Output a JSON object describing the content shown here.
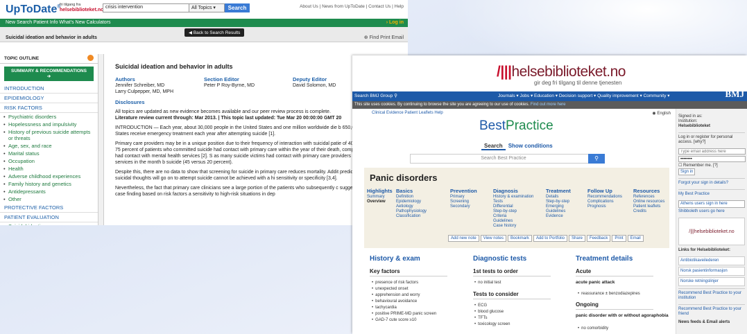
{
  "utd": {
    "logo": "UpToDate",
    "reg": "®",
    "free_line1": "fri tilgang fra",
    "free_line2": "helsebiblioteket.no",
    "search_value": "crisis intervention",
    "topics_label": "All Topics",
    "search_button": "Search",
    "top_links": "About Us  |  News from UpToDate  |  Contact Us  |  Help",
    "nav": "New Search   Patient Info   What's New   Calculators",
    "login": "› Log in",
    "back_button": "Back to Search Results",
    "page_title": "Suicidal ideation and behavior in adults",
    "tools": "Find   Print   Email",
    "outline_header": "TOPIC OUTLINE",
    "summary_button": "SUMMARY & RECOMMENDATIONS",
    "outline": [
      {
        "t": "sec",
        "label": "INTRODUCTION"
      },
      {
        "t": "sec",
        "label": "EPIDEMIOLOGY"
      },
      {
        "t": "sec",
        "label": "RISK FACTORS"
      },
      {
        "t": "item",
        "label": "Psychiatric disorders"
      },
      {
        "t": "item",
        "label": "Hopelessness and impulsivity"
      },
      {
        "t": "item",
        "label": "History of previous suicide attempts or threats"
      },
      {
        "t": "item",
        "label": "Age, sex, and race"
      },
      {
        "t": "item",
        "label": "Marital status"
      },
      {
        "t": "item",
        "label": "Occupation"
      },
      {
        "t": "item",
        "label": "Health"
      },
      {
        "t": "item",
        "label": "Adverse childhood experiences"
      },
      {
        "t": "item",
        "label": "Family history and genetics"
      },
      {
        "t": "item",
        "label": "Antidepressants"
      },
      {
        "t": "item",
        "label": "Other"
      },
      {
        "t": "sec",
        "label": "PROTECTIVE FACTORS"
      },
      {
        "t": "sec",
        "label": "PATIENT EVALUATION"
      },
      {
        "t": "item",
        "label": "Suicidal ideation"
      },
      {
        "t": "item",
        "label": "Other evaluation"
      }
    ],
    "article_title": "Suicidal ideation and behavior in adults",
    "authors_h": "Authors",
    "authors": "Jennifer Schreiber, MD\nLarry Culpepper, MD, MPH",
    "section_h": "Section Editor",
    "section": "Peter P Roy-Byrne, MD",
    "deputy_h": "Deputy Editor",
    "deputy": "David Solomon, MD",
    "disclosures": "Disclosures",
    "p1": "All topics are updated as new evidence becomes available and our peer review process is complete.",
    "p1b": "Literature review current through: Mar 2013. | This topic last updated: Tue Mar 20 00:00:00 GMT 20",
    "p2": "INTRODUCTION — Each year, about 30,000 people in the United States and one million worldwide die b 650,000 people in the United States receive emergency treatment each year after attempting suicide [1].",
    "p3": "Primary care providers may be in a unique position due to their frequency of interaction with suicidal patie of 40 studies found that over 75 percent of patients who committed suicide had contact with primary care within the year of their death, compared with one-third who had contact with mental health services [2]. S as many suicide victims had contact with primary care providers as mental health services in the month b suicide (45 versus 20 percent).",
    "p4": "Despite this, there are no data to show that screening for suicide in primary care reduces mortality. Addit predicting which patients with suicidal thoughts will go on to attempt suicide cannot be achieved with a hi sensitivity or specificity [3,4].",
    "p5": "Nevertheless, the fact that primary care clinicians see a large portion of the patients who subsequently c suggests that an approach to case finding based on risk factors a sensitivity to high-risk situations in dep"
  },
  "bp": {
    "hb_logo_a": "/|||",
    "hb_logo_b": "helsebiblioteket.no",
    "hb_tag": "gir deg fri tilgang til denne tjenesten",
    "group_search": "Search BMJ Group",
    "menu": "Journals ▾   Jobs ▾   Education ▾   Decision support ▾   Quality improvement ▾   Community ▾",
    "bmj": "BMJ",
    "cookie": "This site uses cookies. By continuing to browse the site you are agreeing to our use of cookies.",
    "cookie_link": "Find out more here",
    "top_links": "Clinical Evidence      Patient Leaflets      Help",
    "english": "English",
    "logo_a": "Best",
    "logo_b": "Practice",
    "tab_search": "Search",
    "tab_show": "Show conditions",
    "search_placeholder": "Search Best Practice",
    "condition": "Panic disorders",
    "columns": [
      {
        "h": "Highlights",
        "items": [
          "Summary",
          "Overview"
        ]
      },
      {
        "h": "Basics",
        "items": [
          "Definition",
          "Epidemiology",
          "Aetiology",
          "Pathophysiology",
          "Classification"
        ]
      },
      {
        "h": "Prevention",
        "items": [
          "Primary",
          "Screening",
          "Secondary"
        ]
      },
      {
        "h": "Diagnosis",
        "items": [
          "History & examination",
          "Tests",
          "Differential",
          "Step-by-step",
          "Criteria",
          "Guidelines",
          "Case history"
        ]
      },
      {
        "h": "Treatment",
        "items": [
          "Details",
          "Step-by-step",
          "Emerging",
          "Guidelines",
          "Evidence"
        ]
      },
      {
        "h": "Follow Up",
        "items": [
          "Recommendations",
          "Complications",
          "Prognosis"
        ]
      },
      {
        "h": "Resources",
        "items": [
          "References",
          "Online resources",
          "Patient leaflets",
          "Credits"
        ]
      }
    ],
    "actions": [
      "Add new note",
      "View notes",
      "Bookmark",
      "Add to Portfolio",
      "Share",
      "Feedback",
      "Print",
      "Email"
    ],
    "hx_title": "History & exam",
    "dx_title": "Diagnostic tests",
    "tx_title": "Treatment details",
    "key_factors": "Key factors",
    "key_list": [
      "presence of risk factors",
      "unexpected onset",
      "apprehension and worry",
      "behavioural avoidance",
      "tachycardia",
      "positive PRIME-MD panic screen",
      "GAD-7 cute score ≥10"
    ],
    "first_tests": "1st tests to order",
    "first_list": [
      "no initial test"
    ],
    "consider": "Tests to consider",
    "consider_list": [
      "ECG",
      "blood glucose",
      "TFTs",
      "toxicology screen"
    ],
    "acute": "Acute",
    "acute_attack": "acute panic attack",
    "acute_list": [
      "reassurance ± benzodiazepines"
    ],
    "ongoing": "Ongoing",
    "ongoing_bold": "panic disorder with or without agoraphobia",
    "ongoing_list": [
      "no comorbidity"
    ],
    "side": {
      "signed1": "Signed in as:",
      "signed2": "Institution:",
      "signed3": "Helsebiblioteket",
      "login": "Log in or register for personal access. [why?]",
      "email_ph": "Type email address here",
      "pwd": "••••••••",
      "remember": "Remember me. [?]",
      "signin": "Sign in",
      "forgot": "Forgot your sign in details?",
      "mybp": "My Best Practice",
      "athens": "Athens users sign in here",
      "shib": "Shibboleth users go here",
      "hb_box": "/|||helsebiblioteket.no",
      "links_h": "Links for Helsebiblioteket:",
      "links": [
        "Antibiotikaveilederen",
        "Norsk pasientinformasjon",
        "Norske retningslinjer"
      ],
      "rec1": "Recommend Best Practice to your institution",
      "rec2": "Recommend Best Practice to your friend",
      "feeds": "News feeds & Email alerts"
    }
  }
}
